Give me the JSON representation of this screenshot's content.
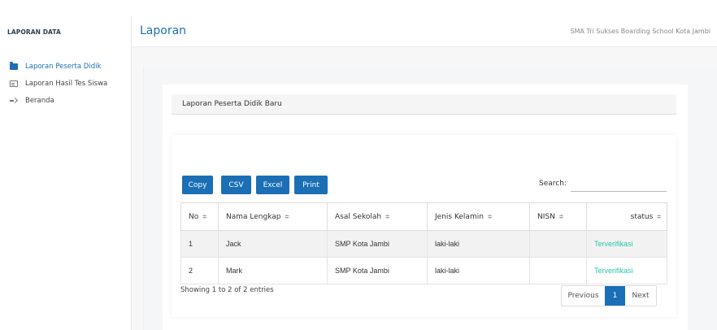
{
  "sidebar": {
    "header": "LAPORAN DATA",
    "items": [
      {
        "label": "Laporan Peserta Didik",
        "icon": "folder-icon"
      },
      {
        "label": "Laporan Hasil Tes Siswa",
        "icon": "book-icon"
      },
      {
        "label": "Beranda",
        "icon": "sign-in-icon"
      }
    ]
  },
  "header": {
    "title": "Laporan",
    "school": "SMA Tri Sukses Boarding School Kota Jambi"
  },
  "panel": {
    "title": "Laporan Peserta Didik Baru"
  },
  "toolbar": {
    "copy": "Copy",
    "csv": "CSV",
    "excel": "Excel",
    "print": "Print",
    "search_label": "Search:",
    "search_value": ""
  },
  "table": {
    "sort_glyph": "≑",
    "columns": [
      "No",
      "Nama Lengkap",
      "Asal Sekolah",
      "Jenis Kelamin",
      "NISN",
      "status"
    ],
    "rows": [
      [
        "1",
        "Jack",
        "SMP Kota Jambi",
        "laki-laki",
        "",
        "Terverifikasi"
      ],
      [
        "2",
        "Mark",
        "SMP Kota Jambi",
        "laki-laki",
        "",
        "Terverifikasi"
      ]
    ]
  },
  "footer": {
    "info": "Showing 1 to 2 of 2 entries",
    "previous": "Previous",
    "current_page": "1",
    "next": "Next"
  },
  "colors": {
    "accent": "#1b6fb5",
    "status_verified": "#29c4b0"
  }
}
